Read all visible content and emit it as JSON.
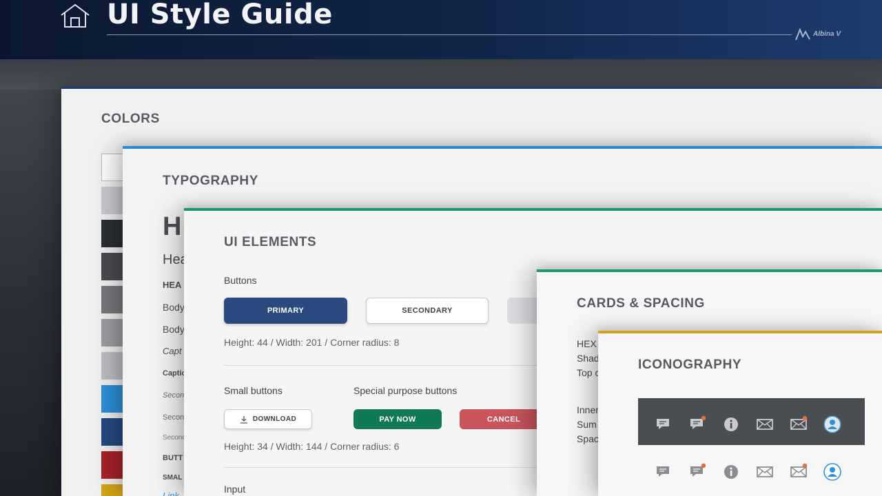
{
  "header": {
    "title": "UI Style Guide",
    "author": "Albina V"
  },
  "colors": {
    "title": "COLORS",
    "swatches": [
      "#ffffff",
      "#c9cad0",
      "#2b2e35",
      "#4a4c52",
      "#76787d",
      "#9c9da2",
      "#bdbec3",
      "#2e8fd9",
      "#244a82",
      "#a8222b",
      "#d6a516"
    ]
  },
  "typography": {
    "title": "TYPOGRAPHY",
    "samples": [
      "H",
      "Hea",
      "HEA",
      "Body",
      "Body",
      "Capt",
      "Captio",
      "Secon",
      "Secon",
      "Seconc",
      "BUTT",
      "SMAL",
      "Link"
    ]
  },
  "ui_elements": {
    "title": "UI ELEMENTS",
    "buttons_label": "Buttons",
    "primary": "PRIMARY",
    "secondary": "SECONDARY",
    "buttons_meta": "Height:  44  /  Width:  201  /  Corner radius:  8",
    "small_buttons_label": "Small buttons",
    "special_label": "Special purpose buttons",
    "download": "DOWNLOAD",
    "pay_now": "PAY NOW",
    "cancel": "CANCEL",
    "small_meta": "Height:  34  /  Width:  144  /  Corner radius:  6",
    "input_label": "Input"
  },
  "cards": {
    "title": "CARDS & SPACING",
    "lines": [
      "HEX",
      "Shad",
      "Top c",
      "Inner",
      "Sum",
      "Spac"
    ]
  },
  "iconography": {
    "title": "ICONOGRAPHY",
    "icons": [
      "chat-icon",
      "chat-notification-icon",
      "info-icon",
      "mail-icon",
      "mail-notification-icon",
      "user-icon"
    ]
  },
  "palette": {
    "primary": "#2a4a80",
    "pay": "#0f7a55",
    "cancel": "#c9545c",
    "notification": "#e2703a",
    "user": "#2e8fd9"
  }
}
